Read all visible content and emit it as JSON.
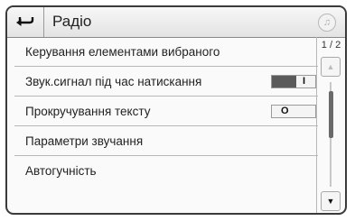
{
  "header": {
    "title": "Радіо",
    "back_icon": "back-arrow-icon",
    "media_icon": "music-note-icon",
    "media_glyph": "♫"
  },
  "list": {
    "items": [
      {
        "label": "Керування елементами вибраного"
      },
      {
        "label": "Звук.сигнал під час натискання",
        "toggle": {
          "state": "on",
          "mark": "I"
        }
      },
      {
        "label": "Прокручування тексту",
        "toggle": {
          "state": "off",
          "mark": "O"
        }
      },
      {
        "label": "Параметри звучання"
      },
      {
        "label": "Автогучність"
      }
    ]
  },
  "scrollbar": {
    "page_indicator": "1 / 2",
    "up_glyph": "▲",
    "down_glyph": "▼"
  }
}
